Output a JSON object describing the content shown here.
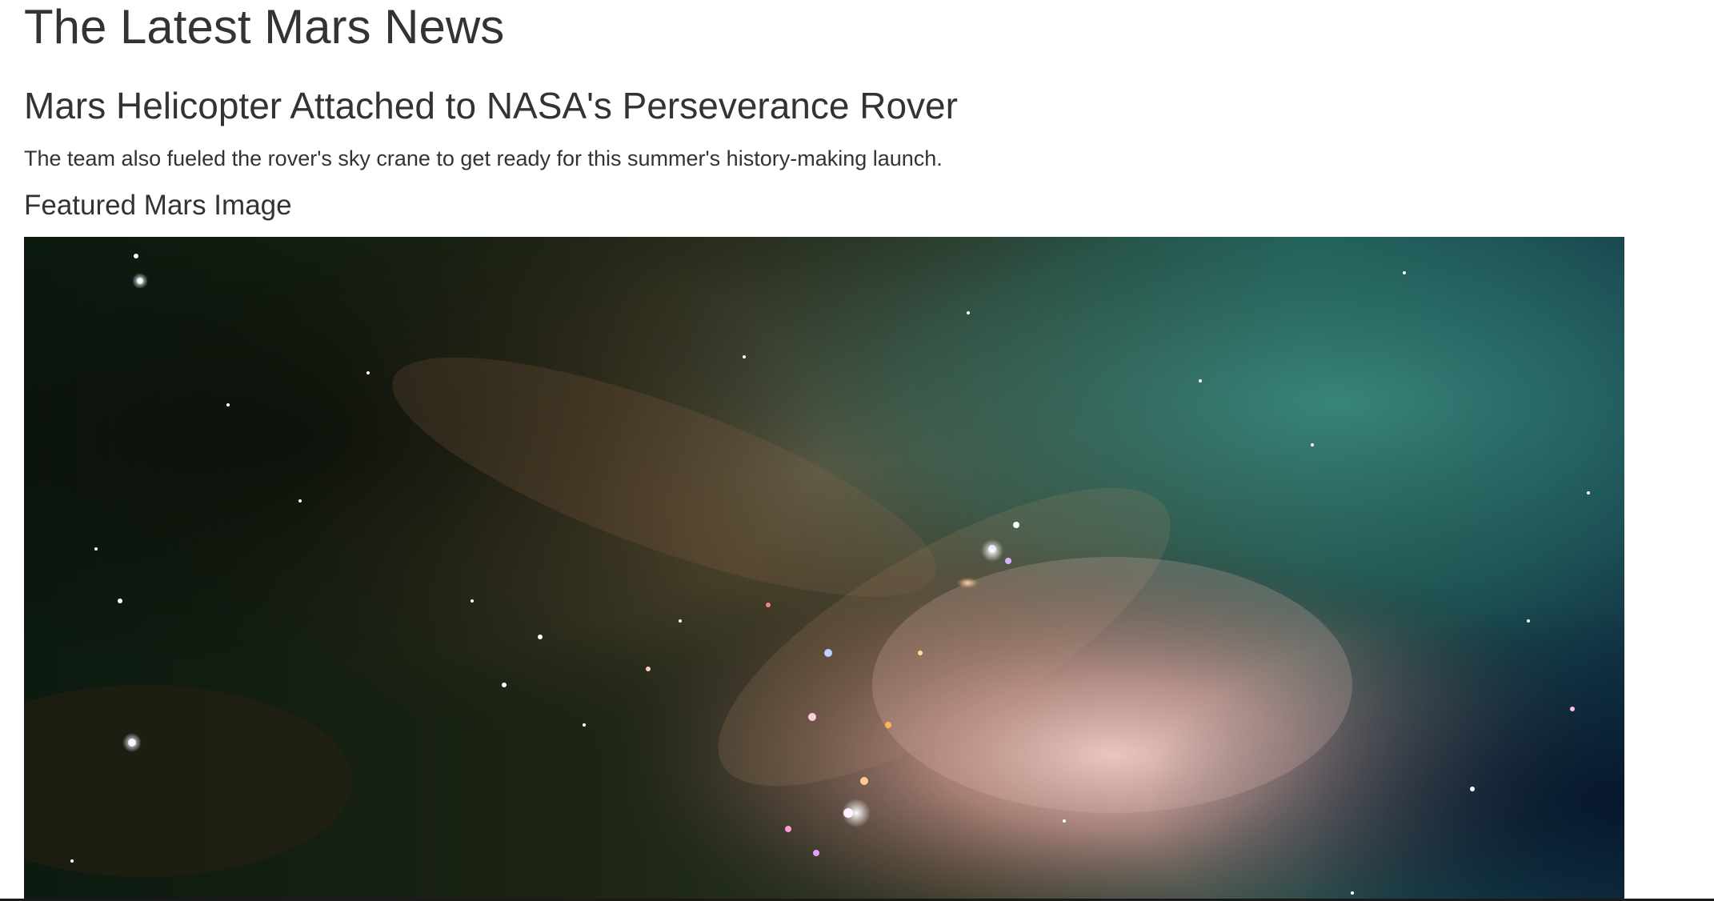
{
  "page": {
    "title": "The Latest Mars News"
  },
  "news": {
    "title": "Mars Helicopter Attached to NASA's Perseverance Rover",
    "teaser": "The team also fueled the rover's sky crane to get ready for this summer's history-making launch."
  },
  "featured": {
    "section_title": "Featured Mars Image"
  }
}
